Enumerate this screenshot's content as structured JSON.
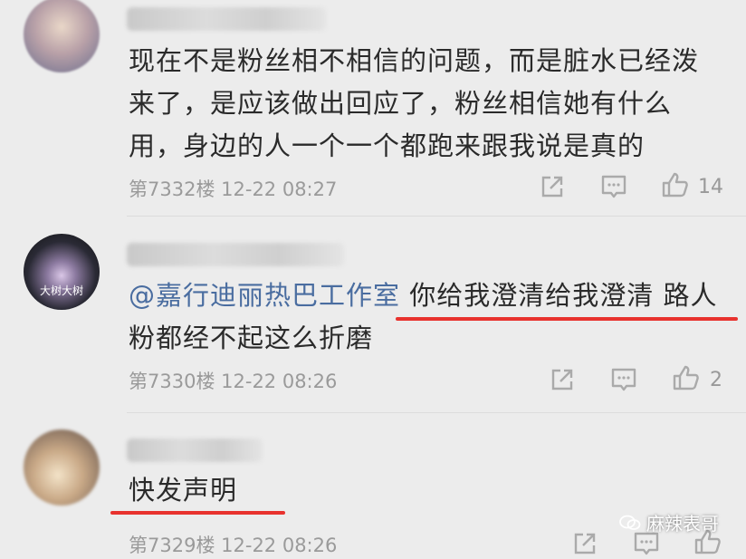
{
  "comments": [
    {
      "lines": [
        "现在不是粉丝相不相信的问题，而是脏水已经泼",
        "来了，是应该做出回应了，粉丝相信她有什么",
        "用，身边的人一个一个都跑来跟我说是真的"
      ],
      "floor": "第7332楼",
      "time": "12-22 08:27",
      "likes": "14"
    },
    {
      "mention": "@嘉行迪丽热巴工作室",
      "line1_rest": " 你给我澄清给我澄清 路人",
      "line2": "粉都经不起这么折磨",
      "avatar_text": "大树大树",
      "floor": "第7330楼",
      "time": "12-22 08:26",
      "likes": "2"
    },
    {
      "lines": [
        "快发声明"
      ],
      "floor": "第7329楼",
      "time": "12-22 08:26"
    }
  ],
  "watermark": "麻辣表哥",
  "icons": {
    "share": "share-icon",
    "comment": "comment-icon",
    "like": "thumbs-up-icon"
  },
  "colors": {
    "mention": "#4a6da0",
    "underline": "#e8322e",
    "background": "#ececec"
  }
}
